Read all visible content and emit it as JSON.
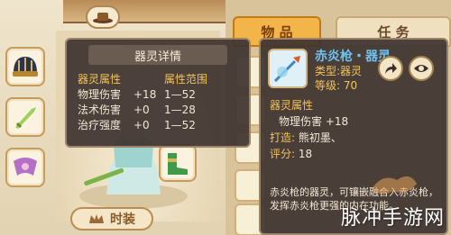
{
  "left_panel": {
    "fashion_button_label": "时装"
  },
  "tabs": {
    "items_label": "物 品",
    "quest_label": "任 务"
  },
  "spirit_details": {
    "title": "器灵详情",
    "col_attr": "器灵属性",
    "col_range": "属性范围",
    "rows": [
      {
        "name": "物理伤害",
        "value": "+18",
        "range": "1—52"
      },
      {
        "name": "法术伤害",
        "value": "+0",
        "range": "1—28"
      },
      {
        "name": "治疗强度",
        "value": "+0",
        "range": "1—52"
      }
    ]
  },
  "item_tooltip": {
    "name": "赤炎枪・器灵",
    "type_label": "类型:",
    "type_value": "器灵",
    "level_label": "等级:",
    "level_value": "70",
    "attr_section": "器灵属性",
    "attr_line": "物理伤害 +18",
    "forged_label": "打造:",
    "forged_value": "熊初墨、",
    "score_label": "评分:",
    "score_value": "18",
    "description": "赤炎枪的器灵，可镶嵌融合入赤炎枪，发挥赤炎枪更强的内在功能。"
  },
  "watermark": "脉冲手游网",
  "icons": [
    "hat-icon",
    "helmet-icon",
    "jade-weapon-icon",
    "ribbon-icon",
    "boots-icon",
    "spear-icon",
    "share-icon",
    "eye-icon",
    "crown-icon"
  ],
  "colors": {
    "tab_active": "#f3b44a",
    "tooltip_bg": "#3e3430",
    "accent_gold": "#f3c45b",
    "item_name_blue": "#6ec2f2"
  }
}
